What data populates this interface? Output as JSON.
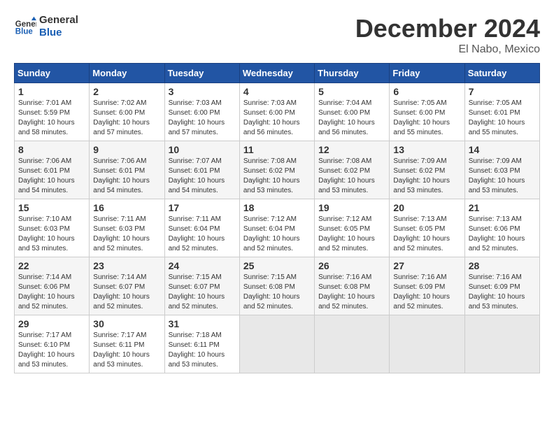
{
  "header": {
    "logo_line1": "General",
    "logo_line2": "Blue",
    "month": "December 2024",
    "location": "El Nabo, Mexico"
  },
  "days_of_week": [
    "Sunday",
    "Monday",
    "Tuesday",
    "Wednesday",
    "Thursday",
    "Friday",
    "Saturday"
  ],
  "weeks": [
    [
      {
        "day": "1",
        "info": "Sunrise: 7:01 AM\nSunset: 5:59 PM\nDaylight: 10 hours\nand 58 minutes."
      },
      {
        "day": "2",
        "info": "Sunrise: 7:02 AM\nSunset: 6:00 PM\nDaylight: 10 hours\nand 57 minutes."
      },
      {
        "day": "3",
        "info": "Sunrise: 7:03 AM\nSunset: 6:00 PM\nDaylight: 10 hours\nand 57 minutes."
      },
      {
        "day": "4",
        "info": "Sunrise: 7:03 AM\nSunset: 6:00 PM\nDaylight: 10 hours\nand 56 minutes."
      },
      {
        "day": "5",
        "info": "Sunrise: 7:04 AM\nSunset: 6:00 PM\nDaylight: 10 hours\nand 56 minutes."
      },
      {
        "day": "6",
        "info": "Sunrise: 7:05 AM\nSunset: 6:00 PM\nDaylight: 10 hours\nand 55 minutes."
      },
      {
        "day": "7",
        "info": "Sunrise: 7:05 AM\nSunset: 6:01 PM\nDaylight: 10 hours\nand 55 minutes."
      }
    ],
    [
      {
        "day": "8",
        "info": "Sunrise: 7:06 AM\nSunset: 6:01 PM\nDaylight: 10 hours\nand 54 minutes."
      },
      {
        "day": "9",
        "info": "Sunrise: 7:06 AM\nSunset: 6:01 PM\nDaylight: 10 hours\nand 54 minutes."
      },
      {
        "day": "10",
        "info": "Sunrise: 7:07 AM\nSunset: 6:01 PM\nDaylight: 10 hours\nand 54 minutes."
      },
      {
        "day": "11",
        "info": "Sunrise: 7:08 AM\nSunset: 6:02 PM\nDaylight: 10 hours\nand 53 minutes."
      },
      {
        "day": "12",
        "info": "Sunrise: 7:08 AM\nSunset: 6:02 PM\nDaylight: 10 hours\nand 53 minutes."
      },
      {
        "day": "13",
        "info": "Sunrise: 7:09 AM\nSunset: 6:02 PM\nDaylight: 10 hours\nand 53 minutes."
      },
      {
        "day": "14",
        "info": "Sunrise: 7:09 AM\nSunset: 6:03 PM\nDaylight: 10 hours\nand 53 minutes."
      }
    ],
    [
      {
        "day": "15",
        "info": "Sunrise: 7:10 AM\nSunset: 6:03 PM\nDaylight: 10 hours\nand 53 minutes."
      },
      {
        "day": "16",
        "info": "Sunrise: 7:11 AM\nSunset: 6:03 PM\nDaylight: 10 hours\nand 52 minutes."
      },
      {
        "day": "17",
        "info": "Sunrise: 7:11 AM\nSunset: 6:04 PM\nDaylight: 10 hours\nand 52 minutes."
      },
      {
        "day": "18",
        "info": "Sunrise: 7:12 AM\nSunset: 6:04 PM\nDaylight: 10 hours\nand 52 minutes."
      },
      {
        "day": "19",
        "info": "Sunrise: 7:12 AM\nSunset: 6:05 PM\nDaylight: 10 hours\nand 52 minutes."
      },
      {
        "day": "20",
        "info": "Sunrise: 7:13 AM\nSunset: 6:05 PM\nDaylight: 10 hours\nand 52 minutes."
      },
      {
        "day": "21",
        "info": "Sunrise: 7:13 AM\nSunset: 6:06 PM\nDaylight: 10 hours\nand 52 minutes."
      }
    ],
    [
      {
        "day": "22",
        "info": "Sunrise: 7:14 AM\nSunset: 6:06 PM\nDaylight: 10 hours\nand 52 minutes."
      },
      {
        "day": "23",
        "info": "Sunrise: 7:14 AM\nSunset: 6:07 PM\nDaylight: 10 hours\nand 52 minutes."
      },
      {
        "day": "24",
        "info": "Sunrise: 7:15 AM\nSunset: 6:07 PM\nDaylight: 10 hours\nand 52 minutes."
      },
      {
        "day": "25",
        "info": "Sunrise: 7:15 AM\nSunset: 6:08 PM\nDaylight: 10 hours\nand 52 minutes."
      },
      {
        "day": "26",
        "info": "Sunrise: 7:16 AM\nSunset: 6:08 PM\nDaylight: 10 hours\nand 52 minutes."
      },
      {
        "day": "27",
        "info": "Sunrise: 7:16 AM\nSunset: 6:09 PM\nDaylight: 10 hours\nand 52 minutes."
      },
      {
        "day": "28",
        "info": "Sunrise: 7:16 AM\nSunset: 6:09 PM\nDaylight: 10 hours\nand 53 minutes."
      }
    ],
    [
      {
        "day": "29",
        "info": "Sunrise: 7:17 AM\nSunset: 6:10 PM\nDaylight: 10 hours\nand 53 minutes."
      },
      {
        "day": "30",
        "info": "Sunrise: 7:17 AM\nSunset: 6:11 PM\nDaylight: 10 hours\nand 53 minutes."
      },
      {
        "day": "31",
        "info": "Sunrise: 7:18 AM\nSunset: 6:11 PM\nDaylight: 10 hours\nand 53 minutes."
      },
      {
        "day": "",
        "info": ""
      },
      {
        "day": "",
        "info": ""
      },
      {
        "day": "",
        "info": ""
      },
      {
        "day": "",
        "info": ""
      }
    ]
  ]
}
